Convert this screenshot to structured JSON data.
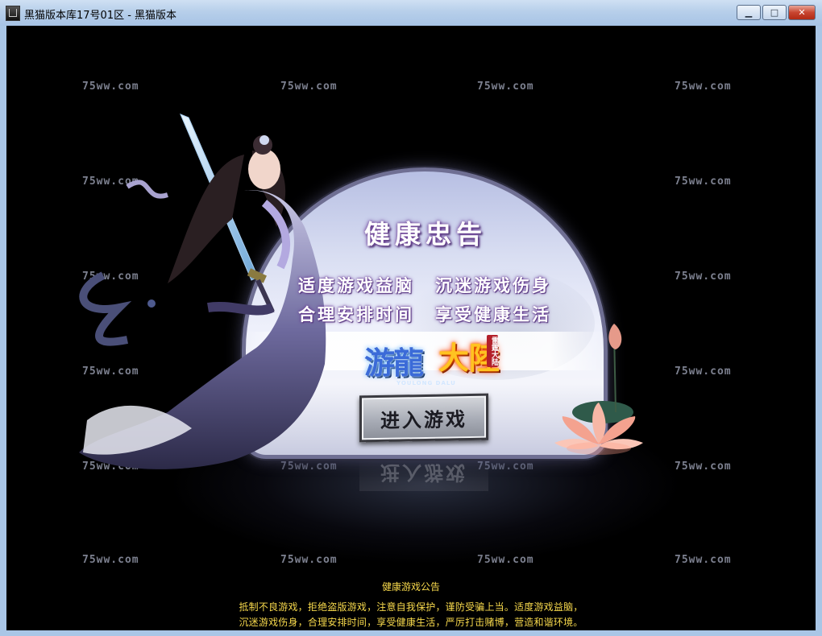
{
  "window": {
    "title": "黑猫版本库17号01区 - 黑猫版本",
    "minimize_glyph": "▁",
    "maximize_glyph": "□",
    "close_glyph": "✕"
  },
  "watermark": "75ww.com",
  "launcher": {
    "heading": "健康忠告",
    "slogans": [
      "适度游戏益脑",
      "沉迷游戏伤身",
      "合理安排时间",
      "享受健康生活"
    ],
    "logo": {
      "title_left": "游龍",
      "title_right": "大陸",
      "seal": "雷霆大陆",
      "subtitle": "YOULONG DALU"
    },
    "enter_button": "进入游戏"
  },
  "notice": {
    "title": "健康游戏公告",
    "line1": "抵制不良游戏，拒绝盗版游戏，注意自我保护，谨防受骗上当。适度游戏益脑，",
    "line2": "沉迷游戏伤身，合理安排时间，享受健康生活，严厉打击赌博，营造和谐环境。"
  },
  "colors": {
    "notice_text": "#f7d94c",
    "arch_border": "#6f6f93",
    "title_glow": "#6b3f99",
    "background": "#000000"
  }
}
